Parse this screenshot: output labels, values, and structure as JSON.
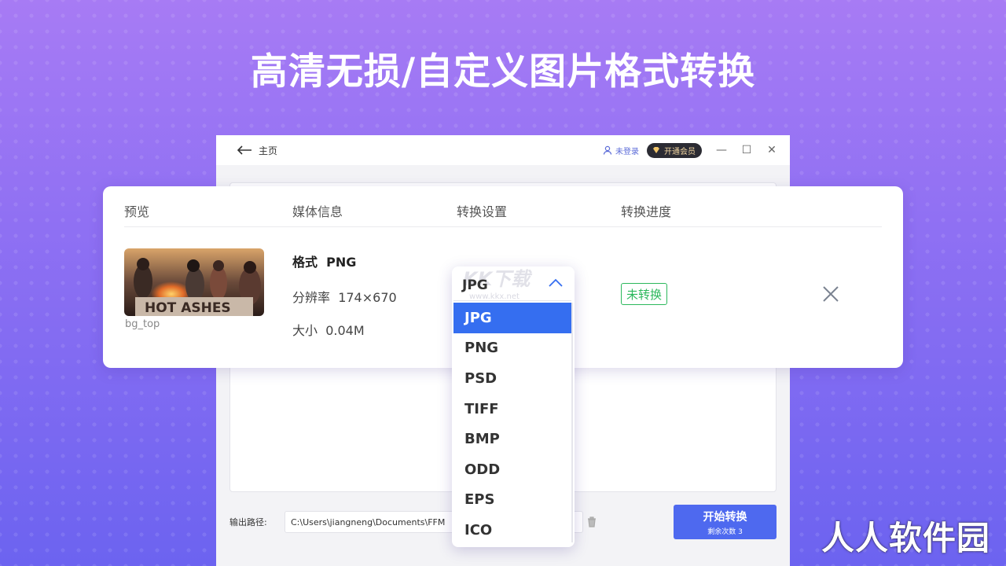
{
  "headline": "高清无损/自定义图片格式转换",
  "window": {
    "back_label": "主页",
    "user_label": "未登录",
    "vip_label": "开通会员"
  },
  "table": {
    "columns": [
      "预览",
      "媒体信息",
      "转换设置",
      "转换进度"
    ],
    "row": {
      "filename": "bg_top",
      "thumb_caption": "HOT ASHES",
      "format_label": "格式",
      "format_value": "PNG",
      "resolution_label": "分辨率",
      "resolution_value": "174×670",
      "size_label": "大小",
      "size_value": "0.04M",
      "status": "未转换"
    }
  },
  "dropdown": {
    "selected": "JPG",
    "options": [
      "JPG",
      "PNG",
      "PSD",
      "TIFF",
      "BMP",
      "ODD",
      "EPS",
      "ICO"
    ],
    "active_index": 0,
    "watermark": "KK下载",
    "watermark_url": "www.kkx.net"
  },
  "output": {
    "label": "输出路径:",
    "path": "C:\\Users\\jiangneng\\Documents\\FFM"
  },
  "start_button": {
    "label": "开始转换",
    "sub_label": "剩余次数 3"
  },
  "brand": "人人软件园",
  "colors": {
    "accent": "#4e69ef",
    "dropdown_active": "#356ef0",
    "status_green": "#2cb85c"
  }
}
